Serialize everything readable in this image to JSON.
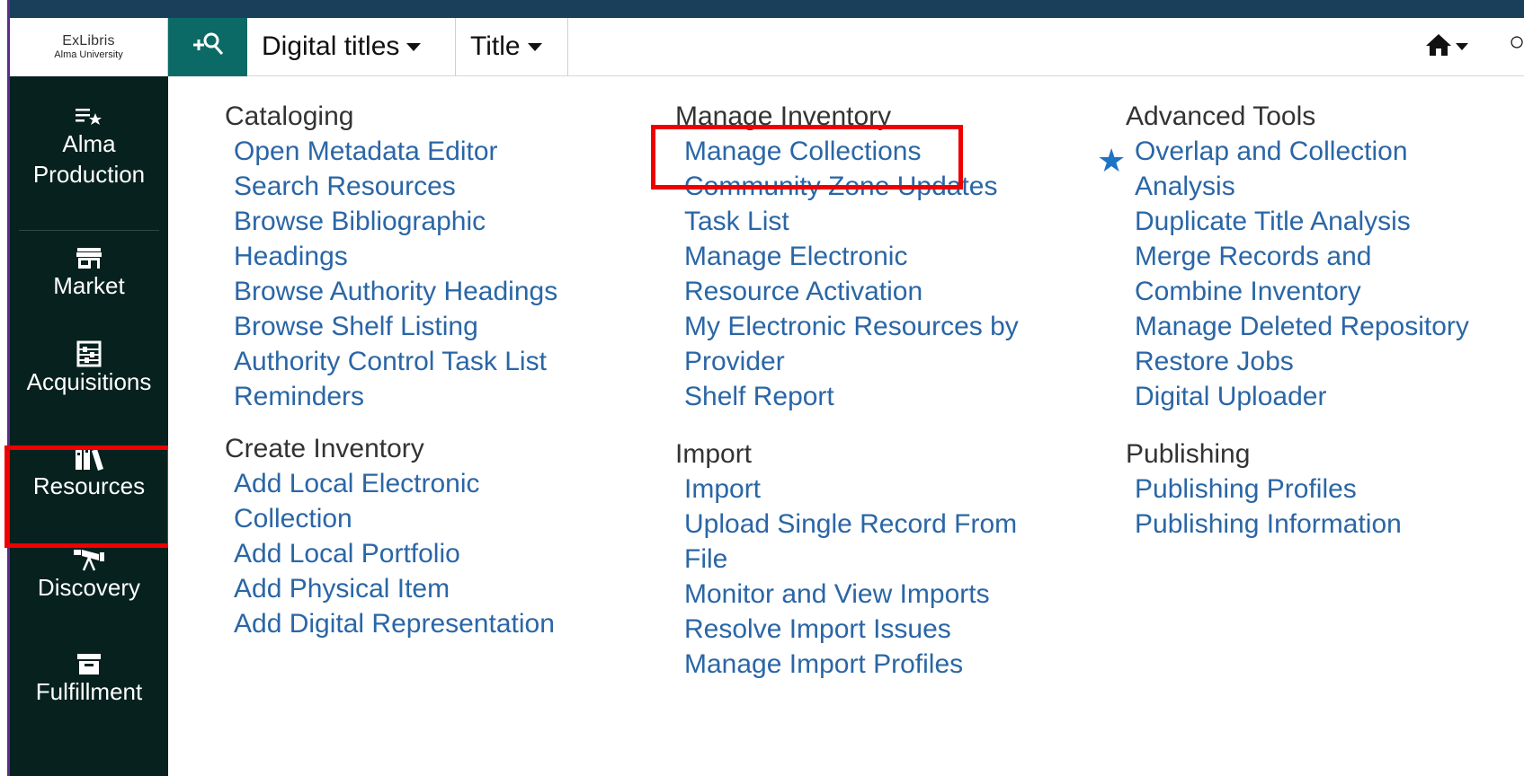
{
  "logo": {
    "main": "ExLibris",
    "sub": "Alma University"
  },
  "header": {
    "search_scope": "Digital titles",
    "search_field": "Title",
    "home_icon": "home-icon",
    "search_icon": "search-person-icon"
  },
  "sidebar": {
    "items": [
      {
        "label": "Alma Production",
        "icon": "list-star-icon"
      },
      {
        "label": "Market",
        "icon": "store-icon"
      },
      {
        "label": "Acquisitions",
        "icon": "abacus-icon"
      },
      {
        "label": "Resources",
        "icon": "books-icon"
      },
      {
        "label": "Discovery",
        "icon": "telescope-icon"
      },
      {
        "label": "Fulfillment",
        "icon": "archive-box-icon"
      }
    ]
  },
  "menu": {
    "col1": [
      {
        "title": "Cataloging",
        "links": [
          "Open Metadata Editor",
          "Search Resources",
          "Browse Bibliographic Headings",
          "Browse Authority Headings",
          "Browse Shelf Listing",
          "Authority Control Task List",
          "Reminders"
        ]
      },
      {
        "title": "Create Inventory",
        "links": [
          "Add Local Electronic Collection",
          "Add Local Portfolio",
          "Add Physical Item",
          "Add Digital Representation"
        ]
      }
    ],
    "col2": [
      {
        "title": "Manage Inventory",
        "links": [
          "Manage Collections",
          "Community Zone Updates Task List",
          "Manage Electronic Resource Activation",
          "My Electronic Resources by Provider",
          "Shelf Report"
        ]
      },
      {
        "title": "Import",
        "links": [
          "Import",
          "Upload Single Record From File",
          "Monitor and View Imports",
          "Resolve Import Issues",
          "Manage Import Profiles"
        ]
      }
    ],
    "col3": [
      {
        "title": "Advanced Tools",
        "links": [
          "Overlap and Collection Analysis",
          "Duplicate Title Analysis",
          "Merge Records and Combine Inventory",
          "Manage Deleted Repository",
          "Restore Jobs",
          "Digital Uploader"
        ]
      },
      {
        "title": "Publishing",
        "links": [
          "Publishing Profiles",
          "Publishing Information"
        ]
      }
    ]
  },
  "colors": {
    "accent_teal": "#0c6a66",
    "sidebar_bg": "#06211e",
    "link": "#2a66a6",
    "highlight": "#e00000",
    "star": "#1d73c4"
  }
}
